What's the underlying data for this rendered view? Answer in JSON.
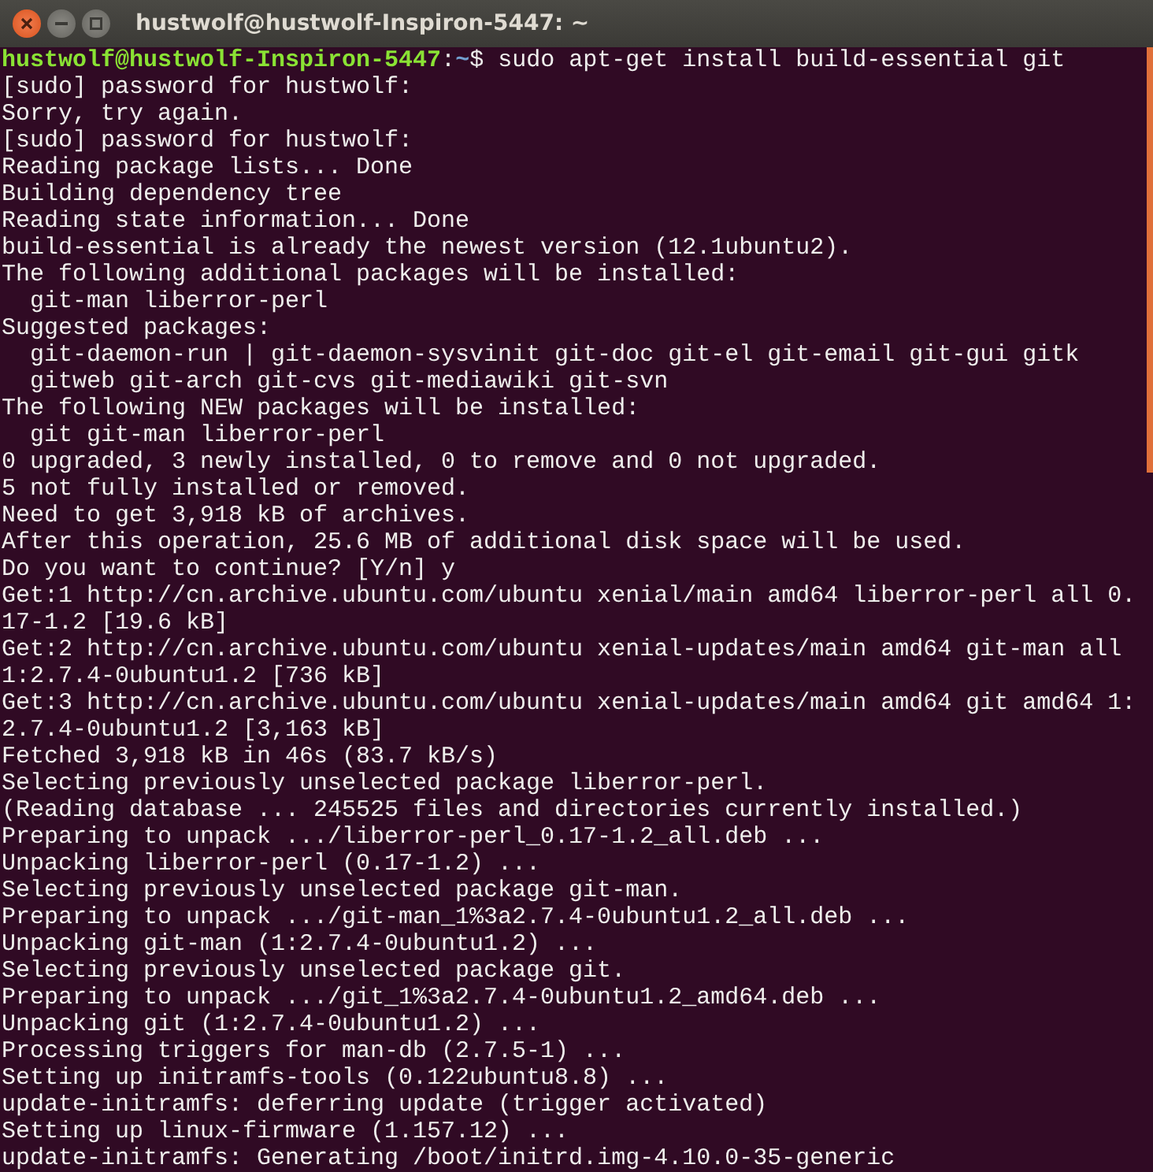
{
  "window": {
    "title": "hustwolf@hustwolf-Inspiron-5447: ~"
  },
  "terminal": {
    "lines": [
      {
        "kind": "prompt",
        "user_host": "hustwolf@hustwolf-Inspiron-5447",
        "separator": ":",
        "path": "~",
        "symbol": "$",
        "command": "sudo apt-get install build-essential git"
      },
      {
        "kind": "output",
        "text": "[sudo] password for hustwolf:"
      },
      {
        "kind": "output",
        "text": "Sorry, try again."
      },
      {
        "kind": "output",
        "text": "[sudo] password for hustwolf:"
      },
      {
        "kind": "output",
        "text": "Reading package lists... Done"
      },
      {
        "kind": "output",
        "text": "Building dependency tree"
      },
      {
        "kind": "output",
        "text": "Reading state information... Done"
      },
      {
        "kind": "output",
        "text": "build-essential is already the newest version (12.1ubuntu2)."
      },
      {
        "kind": "output",
        "text": "The following additional packages will be installed:"
      },
      {
        "kind": "output",
        "text": "  git-man liberror-perl"
      },
      {
        "kind": "output",
        "text": "Suggested packages:"
      },
      {
        "kind": "output",
        "text": "  git-daemon-run | git-daemon-sysvinit git-doc git-el git-email git-gui gitk"
      },
      {
        "kind": "output",
        "text": "  gitweb git-arch git-cvs git-mediawiki git-svn"
      },
      {
        "kind": "output",
        "text": "The following NEW packages will be installed:"
      },
      {
        "kind": "output",
        "text": "  git git-man liberror-perl"
      },
      {
        "kind": "output",
        "text": "0 upgraded, 3 newly installed, 0 to remove and 0 not upgraded."
      },
      {
        "kind": "output",
        "text": "5 not fully installed or removed."
      },
      {
        "kind": "output",
        "text": "Need to get 3,918 kB of archives."
      },
      {
        "kind": "output",
        "text": "After this operation, 25.6 MB of additional disk space will be used."
      },
      {
        "kind": "output",
        "text": "Do you want to continue? [Y/n] y"
      },
      {
        "kind": "output",
        "text": "Get:1 http://cn.archive.ubuntu.com/ubuntu xenial/main amd64 liberror-perl all 0."
      },
      {
        "kind": "output",
        "text": "17-1.2 [19.6 kB]"
      },
      {
        "kind": "output",
        "text": "Get:2 http://cn.archive.ubuntu.com/ubuntu xenial-updates/main amd64 git-man all"
      },
      {
        "kind": "output",
        "text": "1:2.7.4-0ubuntu1.2 [736 kB]"
      },
      {
        "kind": "output",
        "text": "Get:3 http://cn.archive.ubuntu.com/ubuntu xenial-updates/main amd64 git amd64 1:"
      },
      {
        "kind": "output",
        "text": "2.7.4-0ubuntu1.2 [3,163 kB]"
      },
      {
        "kind": "output",
        "text": "Fetched 3,918 kB in 46s (83.7 kB/s)"
      },
      {
        "kind": "output",
        "text": "Selecting previously unselected package liberror-perl."
      },
      {
        "kind": "output",
        "text": "(Reading database ... 245525 files and directories currently installed.)"
      },
      {
        "kind": "output",
        "text": "Preparing to unpack .../liberror-perl_0.17-1.2_all.deb ..."
      },
      {
        "kind": "output",
        "text": "Unpacking liberror-perl (0.17-1.2) ..."
      },
      {
        "kind": "output",
        "text": "Selecting previously unselected package git-man."
      },
      {
        "kind": "output",
        "text": "Preparing to unpack .../git-man_1%3a2.7.4-0ubuntu1.2_all.deb ..."
      },
      {
        "kind": "output",
        "text": "Unpacking git-man (1:2.7.4-0ubuntu1.2) ..."
      },
      {
        "kind": "output",
        "text": "Selecting previously unselected package git."
      },
      {
        "kind": "output",
        "text": "Preparing to unpack .../git_1%3a2.7.4-0ubuntu1.2_amd64.deb ..."
      },
      {
        "kind": "output",
        "text": "Unpacking git (1:2.7.4-0ubuntu1.2) ..."
      },
      {
        "kind": "output",
        "text": "Processing triggers for man-db (2.7.5-1) ..."
      },
      {
        "kind": "output",
        "text": "Setting up initramfs-tools (0.122ubuntu8.8) ..."
      },
      {
        "kind": "output",
        "text": "update-initramfs: deferring update (trigger activated)"
      },
      {
        "kind": "output",
        "text": "Setting up linux-firmware (1.157.12) ..."
      },
      {
        "kind": "output",
        "text": "update-initramfs: Generating /boot/initrd.img-4.10.0-35-generic"
      }
    ]
  }
}
